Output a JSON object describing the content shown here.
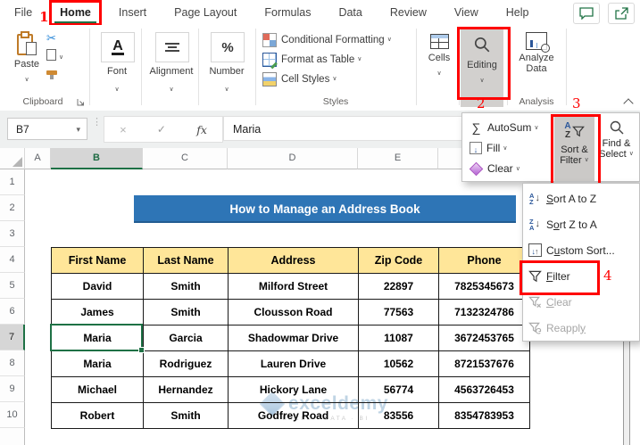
{
  "menu": {
    "tabs": [
      "File",
      "Home",
      "Insert",
      "Page Layout",
      "Formulas",
      "Data",
      "Review",
      "View",
      "Help"
    ],
    "active_tab": "Home"
  },
  "annotations": {
    "step1": "1",
    "step2": "2",
    "step3": "3",
    "step4": "4"
  },
  "ribbon": {
    "paste": "Paste",
    "group_labels": {
      "clipboard": "Clipboard",
      "styles": "Styles",
      "analysis": "Analysis"
    },
    "buttons": {
      "font": "Font",
      "alignment": "Alignment",
      "number": "Number",
      "cells": "Cells",
      "editing": "Editing",
      "analyze_line1": "Analyze",
      "analyze_line2": "Data"
    },
    "styles_menu": [
      "Conditional Formatting",
      "Format as Table",
      "Cell Styles"
    ]
  },
  "formula_bar": {
    "cell_ref": "B7",
    "value": "Maria",
    "fx": "fx"
  },
  "editing_panel": {
    "autosum": "AutoSum",
    "fill": "Fill",
    "clear": "Clear",
    "sort_filter": {
      "line1": "Sort &",
      "line2": "Filter"
    },
    "find_select": {
      "line1": "Find &",
      "line2": "Select"
    }
  },
  "sort_filter_menu": {
    "items": [
      {
        "pre": "",
        "key": "S",
        "post": "ort A to Z",
        "disabled": false
      },
      {
        "pre": "S",
        "key": "o",
        "post": "rt Z to A",
        "disabled": false
      },
      {
        "pre": "C",
        "key": "u",
        "post": "stom Sort...",
        "disabled": false
      },
      {
        "pre": "",
        "key": "F",
        "post": "ilter",
        "disabled": false
      },
      {
        "pre": "",
        "key": "C",
        "post": "lear",
        "disabled": true
      },
      {
        "pre": "Reappl",
        "key": "y",
        "post": "",
        "disabled": true
      }
    ]
  },
  "sheet": {
    "column_letters": [
      "A",
      "B",
      "C",
      "D",
      "E"
    ],
    "row_numbers": [
      "1",
      "2",
      "3",
      "4",
      "5",
      "6",
      "7",
      "8",
      "9",
      "10"
    ],
    "selected_cell": "B7",
    "title": "How to Manage an Address Book",
    "table": {
      "headers": [
        "First Name",
        "Last Name",
        "Address",
        "Zip Code",
        "Phone"
      ],
      "rows": [
        [
          "David",
          "Smith",
          "Milford Street",
          "22897",
          "7825345673"
        ],
        [
          "James",
          "Smith",
          "Clousson Road",
          "77563",
          "7132324786"
        ],
        [
          "Maria",
          "Garcia",
          "Shadowmar Drive",
          "11087",
          "3672453765"
        ],
        [
          "Maria",
          "Rodriguez",
          "Lauren Drive",
          "10562",
          "8721537676"
        ],
        [
          "Michael",
          "Hernandez",
          "Hickory Lane",
          "56774",
          "4563726453"
        ],
        [
          "Robert",
          "Smith",
          "Godfrey Road",
          "83556",
          "8354783953"
        ]
      ]
    }
  },
  "watermark": {
    "brand": "exceldemy",
    "tagline": "EXCEL · DATA · BI"
  },
  "colors": {
    "banner_blue": "#2E75B6",
    "header_yellow": "#FFE699",
    "annotation_red": "#FF0000",
    "excel_green": "#217346"
  }
}
